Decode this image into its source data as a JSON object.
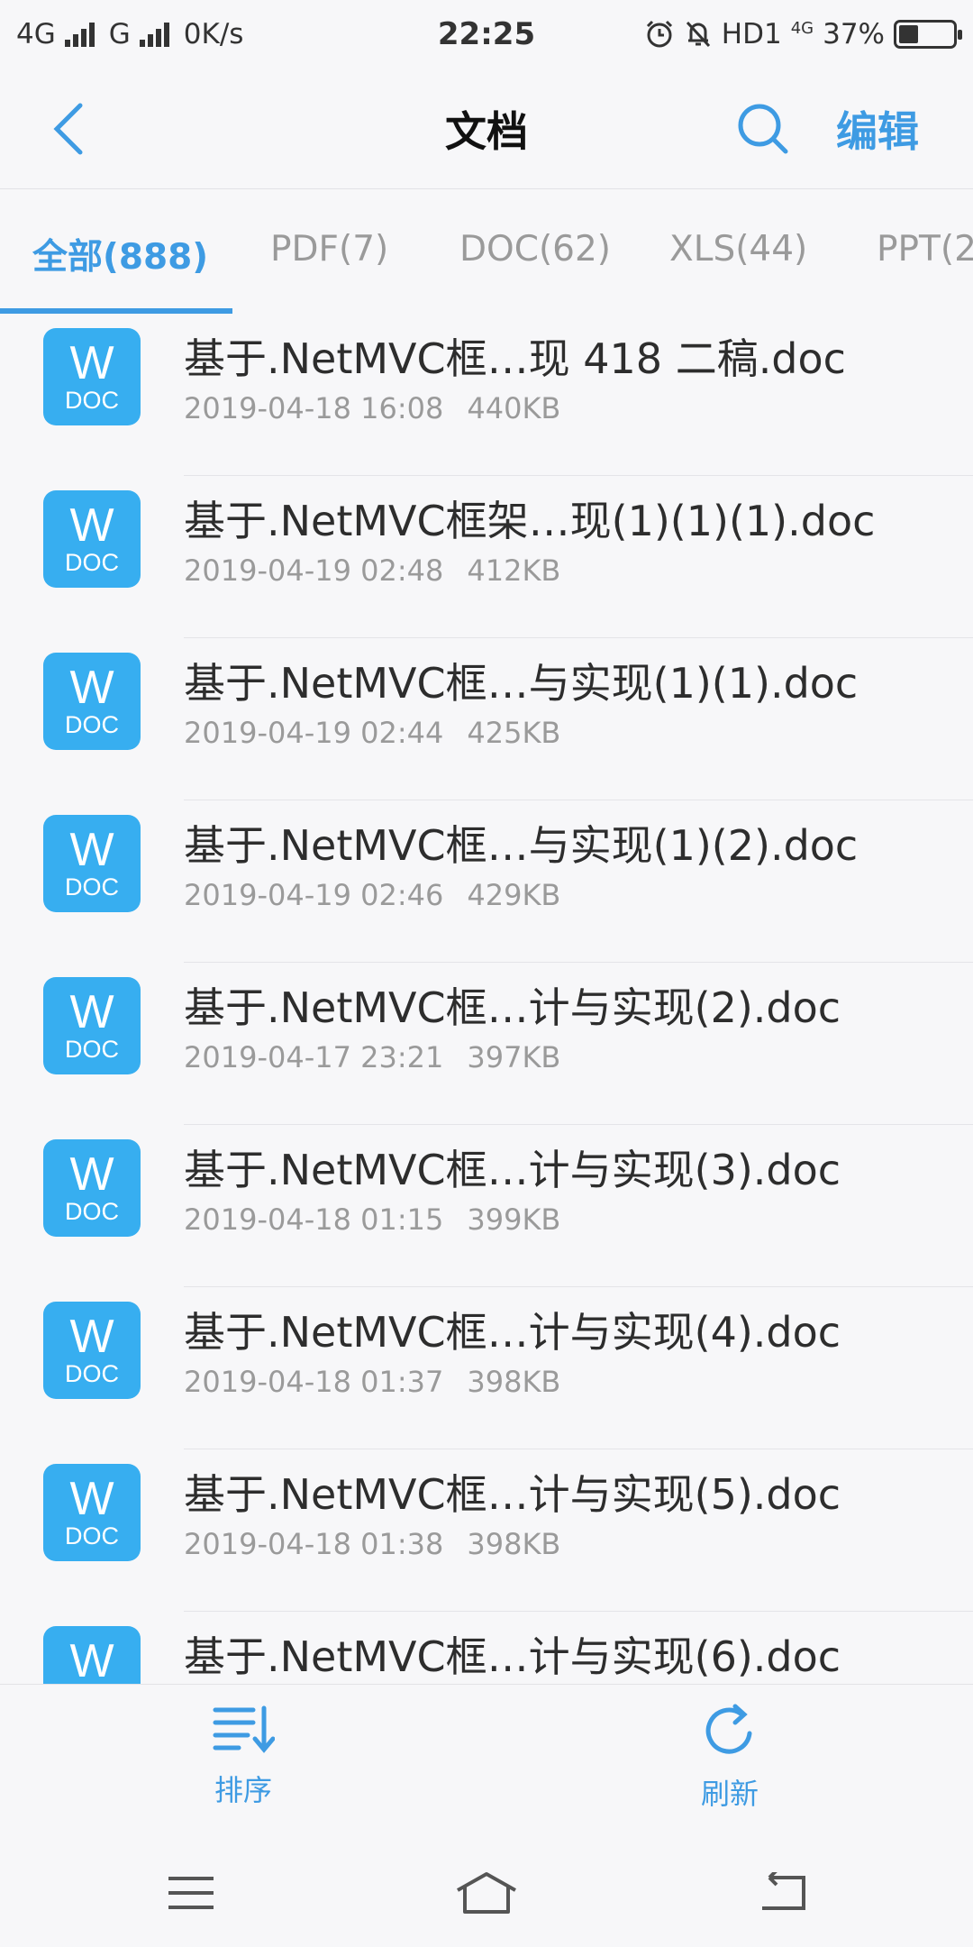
{
  "status_bar": {
    "network_left": "4G",
    "network_mid": "G",
    "speed": "0K/s",
    "time": "22:25",
    "hd": "HD1",
    "net_small": "4G",
    "battery": "37%",
    "battery_level": 0.37
  },
  "header": {
    "title": "文档",
    "edit_label": "编辑"
  },
  "tabs": [
    {
      "label": "全部(888)",
      "active": true
    },
    {
      "label": "PDF(7)",
      "active": false
    },
    {
      "label": "DOC(62)",
      "active": false
    },
    {
      "label": "XLS(44)",
      "active": false
    },
    {
      "label": "PPT(2",
      "active": false
    }
  ],
  "file_icon": {
    "letter": "W",
    "type": "DOC"
  },
  "files": [
    {
      "name": "基于.NetMVC框…现 418 二稿.doc",
      "date": "2019-04-18 16:08",
      "size": "440KB"
    },
    {
      "name": "基于.NetMVC框架…现(1)(1)(1).doc",
      "date": "2019-04-19 02:48",
      "size": "412KB"
    },
    {
      "name": "基于.NetMVC框…与实现(1)(1).doc",
      "date": "2019-04-19 02:44",
      "size": "425KB"
    },
    {
      "name": "基于.NetMVC框…与实现(1)(2).doc",
      "date": "2019-04-19 02:46",
      "size": "429KB"
    },
    {
      "name": "基于.NetMVC框…计与实现(2).doc",
      "date": "2019-04-17 23:21",
      "size": "397KB"
    },
    {
      "name": "基于.NetMVC框…计与实现(3).doc",
      "date": "2019-04-18 01:15",
      "size": "399KB"
    },
    {
      "name": "基于.NetMVC框…计与实现(4).doc",
      "date": "2019-04-18 01:37",
      "size": "398KB"
    },
    {
      "name": "基于.NetMVC框…计与实现(5).doc",
      "date": "2019-04-18 01:38",
      "size": "398KB"
    },
    {
      "name": "基于.NetMVC框…计与实现(6).doc",
      "date": "",
      "size": ""
    }
  ],
  "toolbar": {
    "sort_label": "排序",
    "refresh_label": "刷新"
  },
  "colors": {
    "accent": "#3e9be3",
    "doc_icon": "#37aef0"
  }
}
